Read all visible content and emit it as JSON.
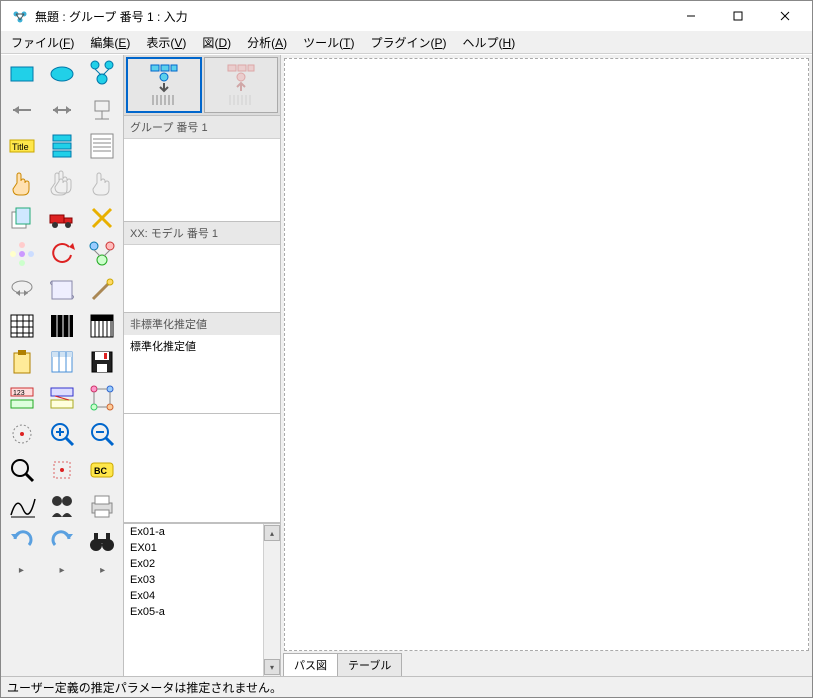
{
  "window": {
    "title": "無題 : グループ 番号 1 : 入力"
  },
  "win_controls": {
    "min": "—",
    "max": "☐",
    "close": "✕"
  },
  "menu": {
    "file": {
      "label": "ファイル",
      "key": "F"
    },
    "edit": {
      "label": "編集",
      "key": "E"
    },
    "view": {
      "label": "表示",
      "key": "V"
    },
    "diagram": {
      "label": "図",
      "key": "D"
    },
    "analyze": {
      "label": "分析",
      "key": "A"
    },
    "tools": {
      "label": "ツール",
      "key": "T"
    },
    "plugins": {
      "label": "プラグイン",
      "key": "P"
    },
    "help": {
      "label": "ヘルプ",
      "key": "H"
    }
  },
  "tools": [
    [
      "rect-observed",
      "ellipse-latent",
      "latent-indicator"
    ],
    [
      "arrow-left",
      "arrow-both",
      "cart"
    ],
    [
      "title-tool",
      "vars-single",
      "vars-list"
    ],
    [
      "hand-single",
      "hand-multi",
      "hand-all"
    ],
    [
      "copy-tool",
      "truck-tool",
      "erase-x"
    ],
    [
      "rotate-flower",
      "rotate-ccw",
      "mirror-latent"
    ],
    [
      "loupe-ellipse",
      "scroll-tool",
      "wand-tool"
    ],
    [
      "matrix-1",
      "matrix-2",
      "matrix-3"
    ],
    [
      "clipboard-tool",
      "spreadsheet-tool",
      "save-tool"
    ],
    [
      "props-a",
      "props-b",
      "tree-tool"
    ],
    [
      "target-tool",
      "zoom-in",
      "zoom-out"
    ],
    [
      "zoom-fit",
      "zoom-center",
      "bayes-bc"
    ],
    [
      "curve-tool",
      "clipart-a",
      "print-tool"
    ],
    [
      "undo",
      "redo",
      "binoculars"
    ]
  ],
  "panels": {
    "group_header": "グループ 番号 1",
    "model_header": "XX: モデル 番号 1",
    "est_unstd": "非標準化推定値",
    "est_std": "標準化推定値"
  },
  "file_list": [
    "Ex01-a",
    "EX01",
    "Ex02",
    "Ex03",
    "Ex04",
    "Ex05-a"
  ],
  "tabs": {
    "path": "パス図",
    "table": "テーブル"
  },
  "status": "ユーザー定義の推定パラメータは推定されません。",
  "thumb_arrows": {
    "down": "↓",
    "up": "↑"
  }
}
